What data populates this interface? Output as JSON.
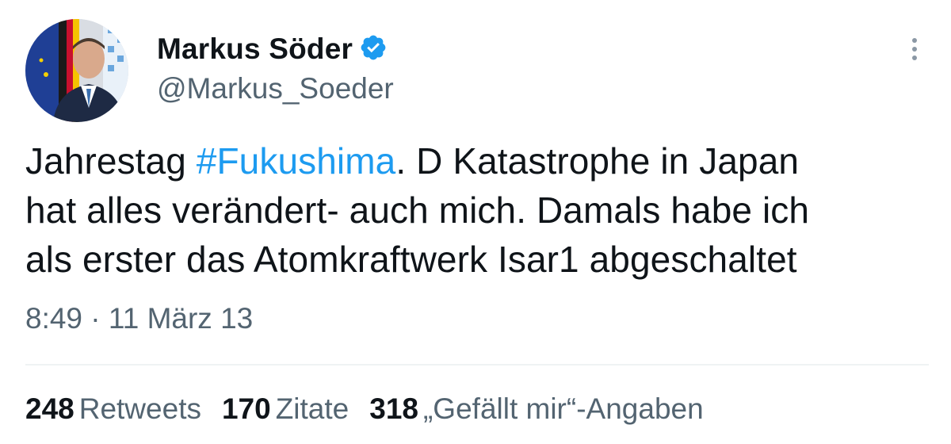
{
  "author": {
    "display_name": "Markus Söder",
    "handle": "@Markus_Soeder",
    "verified": true
  },
  "tweet": {
    "lines": [
      [
        "Jahrestag ",
        "#Fukushima",
        ". D Katastrophe in Japan"
      ],
      [
        "hat alles verändert- auch mich. Damals habe ich"
      ],
      [
        "als erster das Atomkraftwerk Isar1 abgeschaltet"
      ]
    ],
    "hashtag": "#Fukushima",
    "timestamp": "8:49 · 11 März 13"
  },
  "stats": {
    "retweets_count": "248",
    "retweets_label": "Retweets",
    "quotes_count": "170",
    "quotes_label": "Zitate",
    "likes_count": "318",
    "likes_label": "„Gefällt mir“-Angaben"
  },
  "icons": {
    "verified": "verified-badge-icon",
    "more": "more-options-icon"
  },
  "colors": {
    "hashtag": "#1d9bf0",
    "verified": "#1d9bf0",
    "secondary_text": "#536471",
    "primary_text": "#0f1419"
  }
}
